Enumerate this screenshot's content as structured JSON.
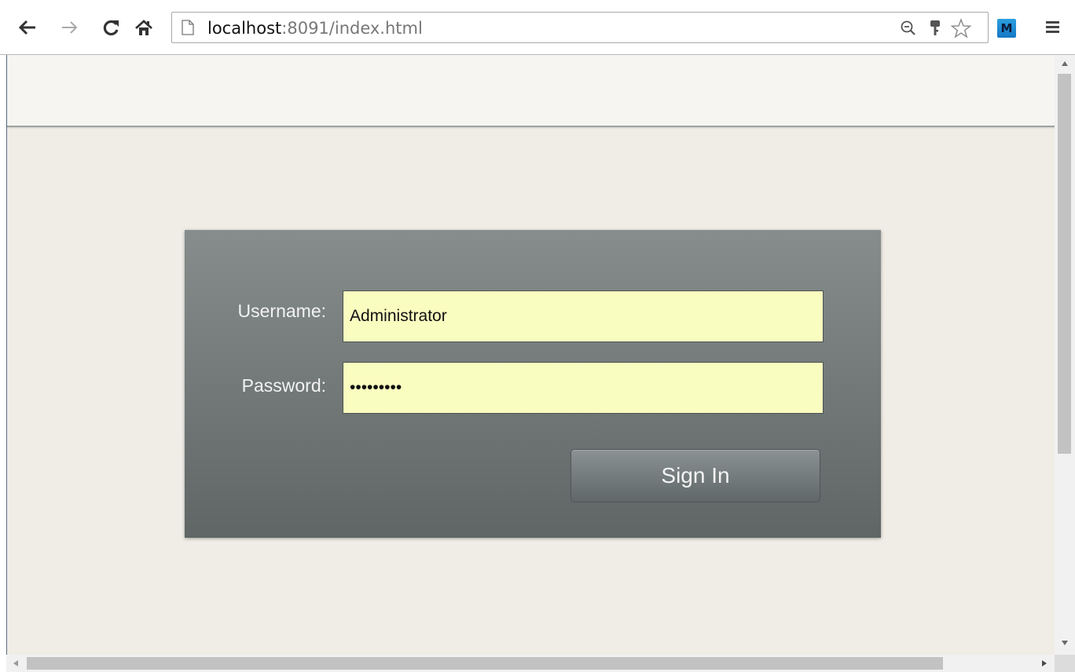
{
  "browser": {
    "url_host": "localhost",
    "url_rest": ":8091/index.html",
    "extension_label": "M",
    "icons": {
      "back": "arrow-left-icon",
      "forward": "arrow-right-icon",
      "reload": "reload-icon",
      "home": "home-icon",
      "page": "page-icon",
      "zoom": "zoom-out-icon",
      "key": "key-icon",
      "bookmark": "star-icon",
      "menu": "hamburger-menu-icon"
    },
    "colors": {
      "extension_bg": "#1e88d6"
    }
  },
  "login": {
    "username_label": "Username:",
    "username_value": "Administrator",
    "password_label": "Password:",
    "password_value": "•••••••••",
    "signin_label": "Sign In",
    "colors": {
      "panel_top": "#868d8c",
      "panel_bottom": "#5f6665",
      "input_bg": "#fafdc0",
      "page_bg": "#f0ede7"
    }
  }
}
